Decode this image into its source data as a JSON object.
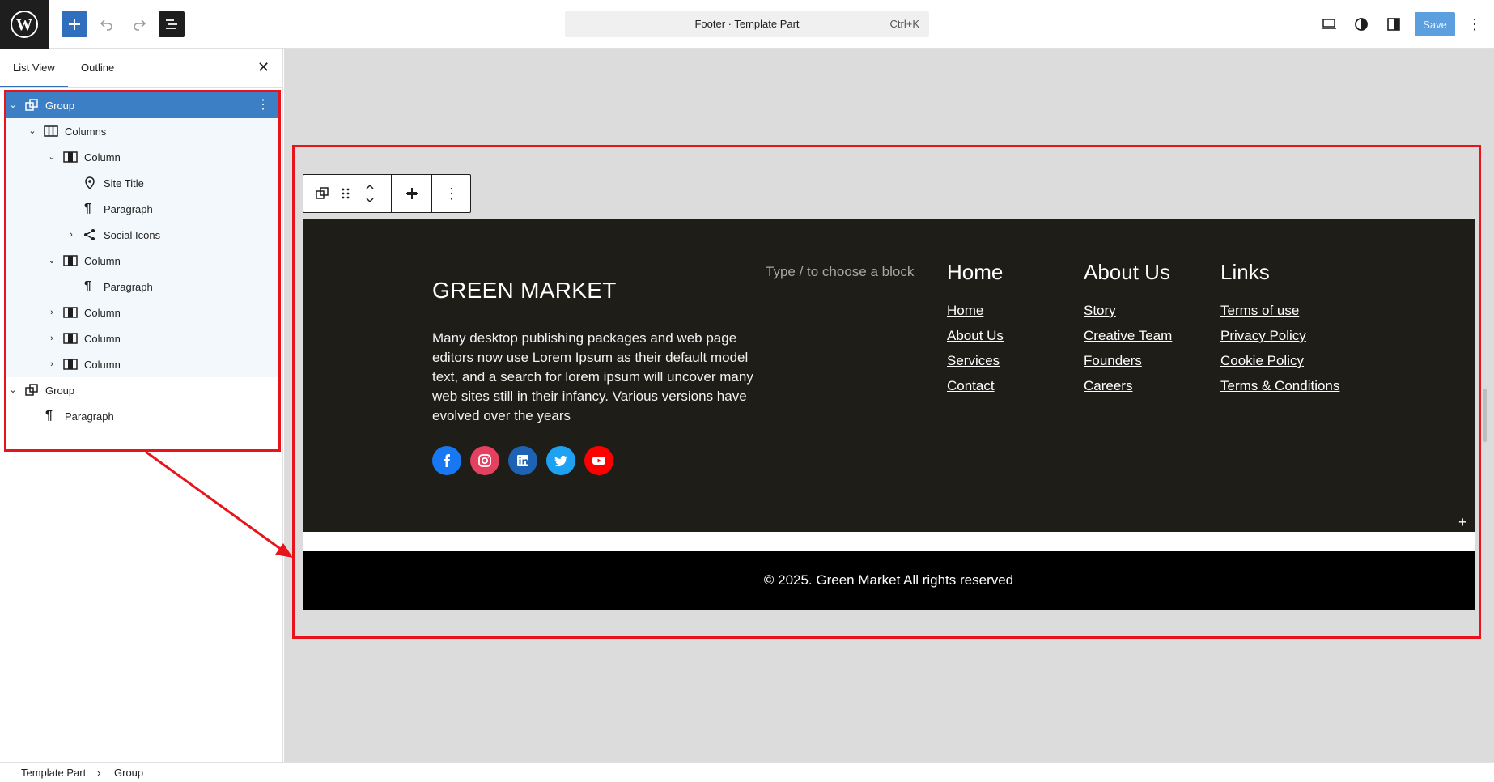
{
  "topbar": {
    "document_title": "Footer · Template Part",
    "shortcut": "Ctrl+K",
    "save_label": "Save",
    "icons": [
      "wordpress-logo",
      "plus-icon",
      "undo-icon",
      "redo-icon",
      "list-view-icon",
      "desktop-preview-icon",
      "style-contrast-icon",
      "sidebar-toggle-icon",
      "more-vertical-icon"
    ]
  },
  "sidebar": {
    "tabs": [
      {
        "label": "List View"
      },
      {
        "label": "Outline"
      }
    ],
    "close_label": "✕",
    "tree": [
      {
        "label": "Group",
        "icon": "group-icon",
        "expanded": true
      },
      {
        "label": "Columns",
        "icon": "columns-icon",
        "expanded": true
      },
      {
        "label": "Column",
        "icon": "column-icon",
        "expanded": true
      },
      {
        "label": "Site Title",
        "icon": "map-marker-icon"
      },
      {
        "label": "Paragraph",
        "icon": "paragraph-icon"
      },
      {
        "label": "Social Icons",
        "icon": "share-icon",
        "expanded": false
      },
      {
        "label": "Column",
        "icon": "column-icon",
        "expanded": true
      },
      {
        "label": "Paragraph",
        "icon": "paragraph-icon"
      },
      {
        "label": "Column",
        "icon": "column-icon",
        "expanded": false
      },
      {
        "label": "Column",
        "icon": "column-icon",
        "expanded": false
      },
      {
        "label": "Column",
        "icon": "column-icon",
        "expanded": false
      },
      {
        "label": "Group",
        "icon": "group-icon",
        "expanded": true
      },
      {
        "label": "Paragraph",
        "icon": "paragraph-icon"
      }
    ]
  },
  "canvas": {
    "site_title": "GREEN MARKET",
    "description": "Many desktop publishing packages and web page editors now use Lorem Ipsum as their default model text, and a search for lorem ipsum will uncover many web sites still in their infancy. Various versions have evolved over the years",
    "block_placeholder": "Type / to choose a block",
    "columns": [
      {
        "heading": "Home",
        "links": [
          "Home",
          "About Us",
          "Services",
          "Contact"
        ]
      },
      {
        "heading": "About Us",
        "links": [
          "Story",
          "Creative Team",
          "Founders",
          "Careers"
        ]
      },
      {
        "heading": "Links",
        "links": [
          "Terms of use",
          "Privacy Policy",
          "Cookie Policy",
          "Terms & Conditions"
        ]
      }
    ],
    "social": [
      {
        "name": "facebook-icon",
        "color": "#1877f2"
      },
      {
        "name": "instagram-icon",
        "color": "#e4405f"
      },
      {
        "name": "linkedin-icon",
        "color": "#1d62b5"
      },
      {
        "name": "twitter-icon",
        "color": "#1da1f2"
      },
      {
        "name": "youtube-icon",
        "color": "#ff0000"
      }
    ],
    "copyright": "© 2025. Green Market All rights reserved"
  },
  "breadcrumb": {
    "items": [
      "Template Part",
      "Group"
    ]
  },
  "colors": {
    "accent": "#2f6fbd",
    "selected": "#3c7fc5",
    "highlight": "#e8141b",
    "footer_bg": "#1f1d18"
  }
}
